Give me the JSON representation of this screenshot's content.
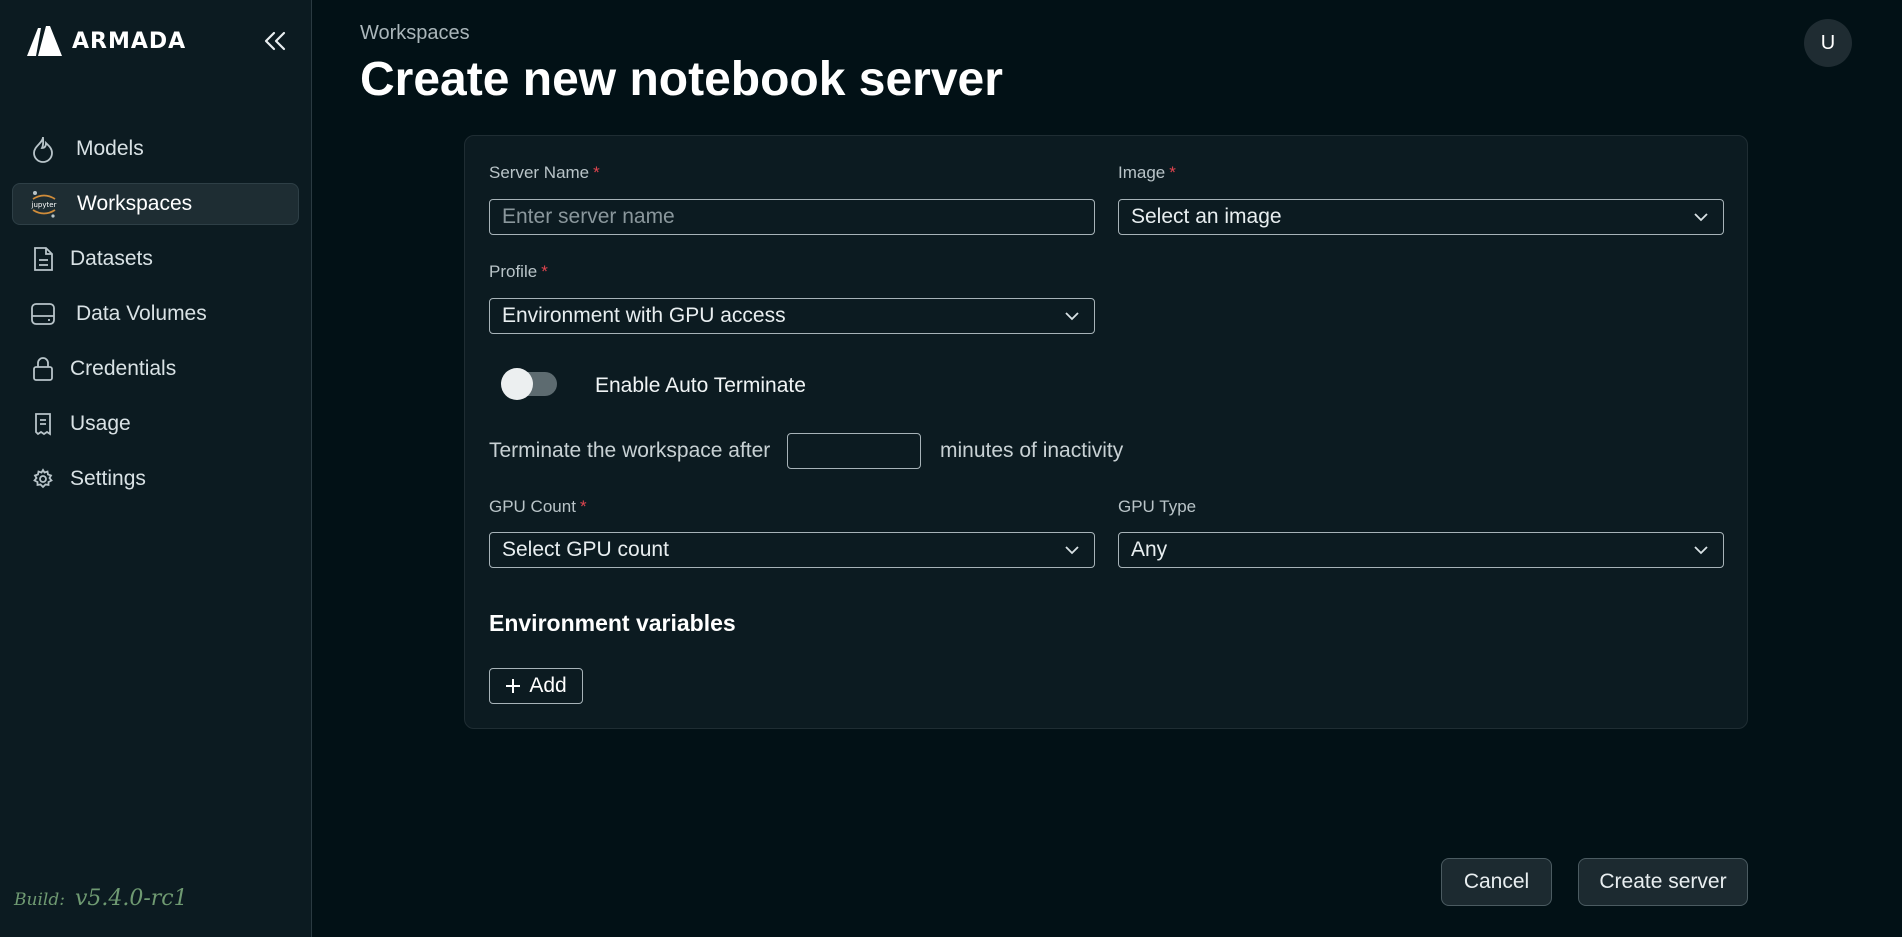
{
  "brand": {
    "name": "ARMADA"
  },
  "sidebar": {
    "items": [
      {
        "label": "Models",
        "icon": "flame-icon"
      },
      {
        "label": "Workspaces",
        "icon": "jupyter-icon",
        "active": true
      },
      {
        "label": "Datasets",
        "icon": "document-icon"
      },
      {
        "label": "Data Volumes",
        "icon": "hard-drive-icon"
      },
      {
        "label": "Credentials",
        "icon": "lock-icon"
      },
      {
        "label": "Usage",
        "icon": "receipt-icon"
      },
      {
        "label": "Settings",
        "icon": "gear-icon"
      }
    ],
    "build_label": "Build:",
    "build_version": "v5.4.0-rc1"
  },
  "header": {
    "breadcrumb": "Workspaces",
    "title": "Create new notebook server",
    "avatar_initial": "U"
  },
  "form": {
    "server_name": {
      "label": "Server Name",
      "required": "*",
      "placeholder": "Enter server name",
      "value": ""
    },
    "image": {
      "label": "Image",
      "required": "*",
      "value": "Select an image"
    },
    "profile": {
      "label": "Profile",
      "required": "*",
      "value": "Environment with GPU access"
    },
    "auto_terminate": {
      "label": "Enable Auto Terminate",
      "enabled": false
    },
    "terminate_prefix": "Terminate the workspace after",
    "terminate_suffix": "minutes of inactivity",
    "terminate_minutes": "",
    "gpu_count": {
      "label": "GPU Count",
      "required": "*",
      "value": "Select GPU count"
    },
    "gpu_type": {
      "label": "GPU Type",
      "value": "Any"
    },
    "env_title": "Environment variables",
    "add_label": "Add"
  },
  "footer": {
    "cancel_label": "Cancel",
    "create_label": "Create server"
  },
  "colors": {
    "background": "#021116",
    "panel": "#0c1b21",
    "required": "#e0454f",
    "build_text": "#6f9a72"
  }
}
